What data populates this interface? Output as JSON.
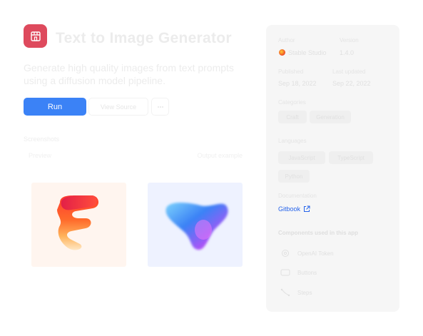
{
  "app": {
    "title": "Text to Image Generator",
    "description": "Generate high quality images from text prompts using a diffusion model pipeline.",
    "run_label": "Run",
    "secondary_label": "View Source",
    "more_icon": "ellipsis-icon",
    "section_label": "Screenshots",
    "captions": [
      "Preview",
      "Output example"
    ]
  },
  "sidebar": {
    "author_label": "Author",
    "author_name": "Stable Studio",
    "version_label": "Version",
    "version_value": "1.4.0",
    "published_label": "Published",
    "published_value": "Sep 18, 2022",
    "updated_label": "Last updated",
    "updated_value": "Sep 22, 2022",
    "categories_label": "Categories",
    "categories": [
      "Craft",
      "Generation"
    ],
    "languages_label": "Languages",
    "languages": [
      "JavaScript",
      "TypeScript",
      "Python"
    ],
    "docs_label": "Documentation",
    "docs_link": "Gitbook",
    "features_heading": "Components used in this app",
    "features": [
      {
        "icon": "chatgpt-icon",
        "label": "OpenAI Token"
      },
      {
        "icon": "button-icon",
        "label": "Buttons"
      },
      {
        "icon": "flow-icon",
        "label": "Steps"
      }
    ]
  },
  "colors": {
    "accent": "#3b82f6",
    "app_icon": "#de4a5d",
    "link": "#2563eb"
  }
}
